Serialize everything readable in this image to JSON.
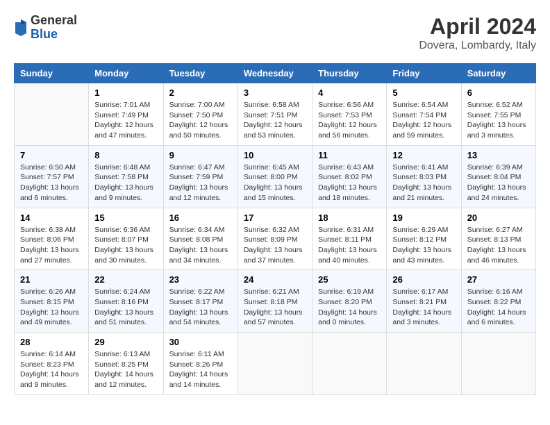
{
  "header": {
    "logo": {
      "line1": "General",
      "line2": "Blue"
    },
    "title": "April 2024",
    "location": "Dovera, Lombardy, Italy"
  },
  "calendar": {
    "weekdays": [
      "Sunday",
      "Monday",
      "Tuesday",
      "Wednesday",
      "Thursday",
      "Friday",
      "Saturday"
    ],
    "rows": [
      [
        {
          "day": "",
          "sunrise": "",
          "sunset": "",
          "daylight": ""
        },
        {
          "day": "1",
          "sunrise": "Sunrise: 7:01 AM",
          "sunset": "Sunset: 7:49 PM",
          "daylight": "Daylight: 12 hours and 47 minutes."
        },
        {
          "day": "2",
          "sunrise": "Sunrise: 7:00 AM",
          "sunset": "Sunset: 7:50 PM",
          "daylight": "Daylight: 12 hours and 50 minutes."
        },
        {
          "day": "3",
          "sunrise": "Sunrise: 6:58 AM",
          "sunset": "Sunset: 7:51 PM",
          "daylight": "Daylight: 12 hours and 53 minutes."
        },
        {
          "day": "4",
          "sunrise": "Sunrise: 6:56 AM",
          "sunset": "Sunset: 7:53 PM",
          "daylight": "Daylight: 12 hours and 56 minutes."
        },
        {
          "day": "5",
          "sunrise": "Sunrise: 6:54 AM",
          "sunset": "Sunset: 7:54 PM",
          "daylight": "Daylight: 12 hours and 59 minutes."
        },
        {
          "day": "6",
          "sunrise": "Sunrise: 6:52 AM",
          "sunset": "Sunset: 7:55 PM",
          "daylight": "Daylight: 13 hours and 3 minutes."
        }
      ],
      [
        {
          "day": "7",
          "sunrise": "Sunrise: 6:50 AM",
          "sunset": "Sunset: 7:57 PM",
          "daylight": "Daylight: 13 hours and 6 minutes."
        },
        {
          "day": "8",
          "sunrise": "Sunrise: 6:48 AM",
          "sunset": "Sunset: 7:58 PM",
          "daylight": "Daylight: 13 hours and 9 minutes."
        },
        {
          "day": "9",
          "sunrise": "Sunrise: 6:47 AM",
          "sunset": "Sunset: 7:59 PM",
          "daylight": "Daylight: 13 hours and 12 minutes."
        },
        {
          "day": "10",
          "sunrise": "Sunrise: 6:45 AM",
          "sunset": "Sunset: 8:00 PM",
          "daylight": "Daylight: 13 hours and 15 minutes."
        },
        {
          "day": "11",
          "sunrise": "Sunrise: 6:43 AM",
          "sunset": "Sunset: 8:02 PM",
          "daylight": "Daylight: 13 hours and 18 minutes."
        },
        {
          "day": "12",
          "sunrise": "Sunrise: 6:41 AM",
          "sunset": "Sunset: 8:03 PM",
          "daylight": "Daylight: 13 hours and 21 minutes."
        },
        {
          "day": "13",
          "sunrise": "Sunrise: 6:39 AM",
          "sunset": "Sunset: 8:04 PM",
          "daylight": "Daylight: 13 hours and 24 minutes."
        }
      ],
      [
        {
          "day": "14",
          "sunrise": "Sunrise: 6:38 AM",
          "sunset": "Sunset: 8:06 PM",
          "daylight": "Daylight: 13 hours and 27 minutes."
        },
        {
          "day": "15",
          "sunrise": "Sunrise: 6:36 AM",
          "sunset": "Sunset: 8:07 PM",
          "daylight": "Daylight: 13 hours and 30 minutes."
        },
        {
          "day": "16",
          "sunrise": "Sunrise: 6:34 AM",
          "sunset": "Sunset: 8:08 PM",
          "daylight": "Daylight: 13 hours and 34 minutes."
        },
        {
          "day": "17",
          "sunrise": "Sunrise: 6:32 AM",
          "sunset": "Sunset: 8:09 PM",
          "daylight": "Daylight: 13 hours and 37 minutes."
        },
        {
          "day": "18",
          "sunrise": "Sunrise: 6:31 AM",
          "sunset": "Sunset: 8:11 PM",
          "daylight": "Daylight: 13 hours and 40 minutes."
        },
        {
          "day": "19",
          "sunrise": "Sunrise: 6:29 AM",
          "sunset": "Sunset: 8:12 PM",
          "daylight": "Daylight: 13 hours and 43 minutes."
        },
        {
          "day": "20",
          "sunrise": "Sunrise: 6:27 AM",
          "sunset": "Sunset: 8:13 PM",
          "daylight": "Daylight: 13 hours and 46 minutes."
        }
      ],
      [
        {
          "day": "21",
          "sunrise": "Sunrise: 6:26 AM",
          "sunset": "Sunset: 8:15 PM",
          "daylight": "Daylight: 13 hours and 49 minutes."
        },
        {
          "day": "22",
          "sunrise": "Sunrise: 6:24 AM",
          "sunset": "Sunset: 8:16 PM",
          "daylight": "Daylight: 13 hours and 51 minutes."
        },
        {
          "day": "23",
          "sunrise": "Sunrise: 6:22 AM",
          "sunset": "Sunset: 8:17 PM",
          "daylight": "Daylight: 13 hours and 54 minutes."
        },
        {
          "day": "24",
          "sunrise": "Sunrise: 6:21 AM",
          "sunset": "Sunset: 8:18 PM",
          "daylight": "Daylight: 13 hours and 57 minutes."
        },
        {
          "day": "25",
          "sunrise": "Sunrise: 6:19 AM",
          "sunset": "Sunset: 8:20 PM",
          "daylight": "Daylight: 14 hours and 0 minutes."
        },
        {
          "day": "26",
          "sunrise": "Sunrise: 6:17 AM",
          "sunset": "Sunset: 8:21 PM",
          "daylight": "Daylight: 14 hours and 3 minutes."
        },
        {
          "day": "27",
          "sunrise": "Sunrise: 6:16 AM",
          "sunset": "Sunset: 8:22 PM",
          "daylight": "Daylight: 14 hours and 6 minutes."
        }
      ],
      [
        {
          "day": "28",
          "sunrise": "Sunrise: 6:14 AM",
          "sunset": "Sunset: 8:23 PM",
          "daylight": "Daylight: 14 hours and 9 minutes."
        },
        {
          "day": "29",
          "sunrise": "Sunrise: 6:13 AM",
          "sunset": "Sunset: 8:25 PM",
          "daylight": "Daylight: 14 hours and 12 minutes."
        },
        {
          "day": "30",
          "sunrise": "Sunrise: 6:11 AM",
          "sunset": "Sunset: 8:26 PM",
          "daylight": "Daylight: 14 hours and 14 minutes."
        },
        {
          "day": "",
          "sunrise": "",
          "sunset": "",
          "daylight": ""
        },
        {
          "day": "",
          "sunrise": "",
          "sunset": "",
          "daylight": ""
        },
        {
          "day": "",
          "sunrise": "",
          "sunset": "",
          "daylight": ""
        },
        {
          "day": "",
          "sunrise": "",
          "sunset": "",
          "daylight": ""
        }
      ]
    ]
  }
}
